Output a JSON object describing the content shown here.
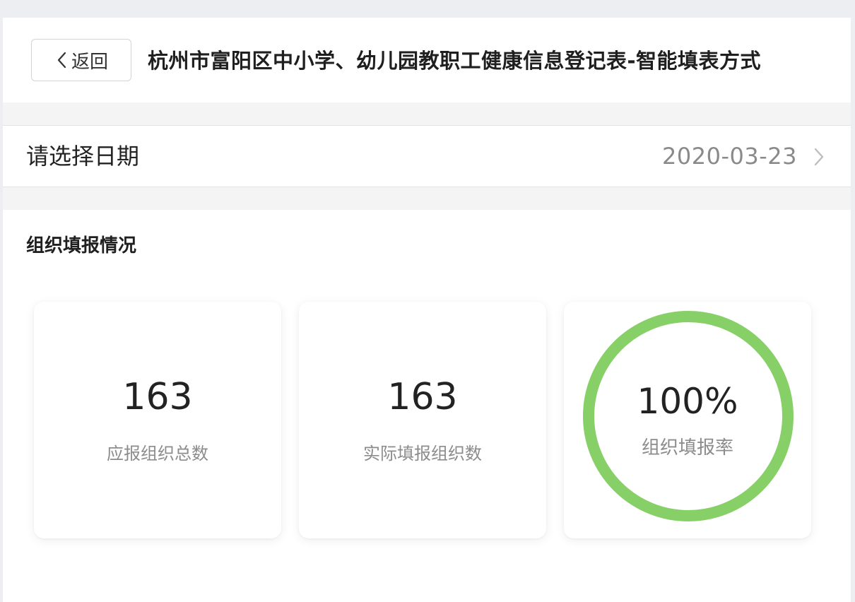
{
  "header": {
    "back_label": "返回",
    "title": "杭州市富阳区中小学、幼儿园教职工健康信息登记表-智能填表方式"
  },
  "date_picker": {
    "label": "请选择日期",
    "value": "2020-03-23",
    "arrow_icon": "chevron-right-icon"
  },
  "stats": {
    "section_title": "组织填报情况",
    "cards": [
      {
        "value": "163",
        "caption": "应报组织总数"
      },
      {
        "value": "163",
        "caption": "实际填报组织数"
      }
    ],
    "rate": {
      "value": "100%",
      "caption": "组织填报率",
      "fraction": 1.0,
      "ring_color": "#87d068"
    }
  },
  "colors": {
    "accent_green": "#87d068",
    "muted_text": "#8c8c8c"
  }
}
